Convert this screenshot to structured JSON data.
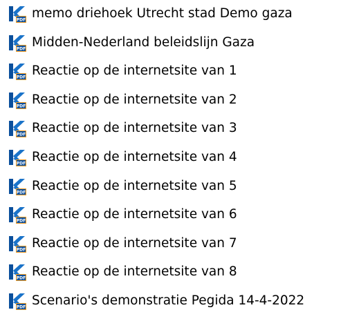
{
  "files": [
    {
      "name": "memo driehoek Utrecht stad Demo gaza",
      "icon": "kofax-pdf-icon"
    },
    {
      "name": "Midden-Nederland beleidslijn Gaza",
      "icon": "kofax-pdf-icon"
    },
    {
      "name": "Reactie op de internetsite van 1",
      "icon": "kofax-pdf-icon"
    },
    {
      "name": "Reactie op de internetsite van 2",
      "icon": "kofax-pdf-icon"
    },
    {
      "name": "Reactie op de internetsite van 3",
      "icon": "kofax-pdf-icon"
    },
    {
      "name": "Reactie op de internetsite van 4",
      "icon": "kofax-pdf-icon"
    },
    {
      "name": "Reactie op de internetsite van 5",
      "icon": "kofax-pdf-icon"
    },
    {
      "name": "Reactie op de internetsite van 6",
      "icon": "kofax-pdf-icon"
    },
    {
      "name": "Reactie op de internetsite van 7",
      "icon": "kofax-pdf-icon"
    },
    {
      "name": "Reactie op de internetsite van 8",
      "icon": "kofax-pdf-icon"
    },
    {
      "name": "Scenario's demonstratie Pegida 14-4-2022",
      "icon": "kofax-pdf-icon"
    }
  ],
  "icon_badge_text": "PDF",
  "colors": {
    "icon_blue": "#1a73c9",
    "icon_dark_blue": "#0b4f9c",
    "icon_orange": "#f39a1e",
    "text": "#000000",
    "background": "#ffffff"
  }
}
